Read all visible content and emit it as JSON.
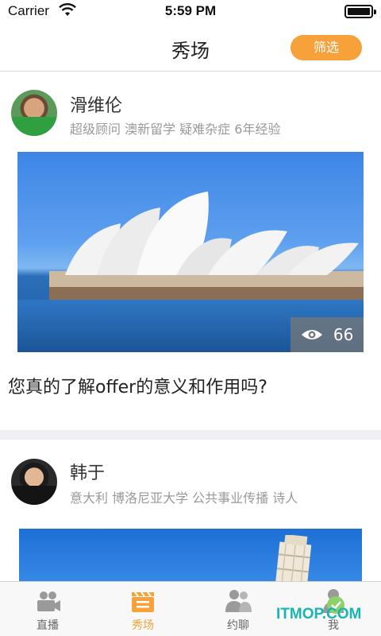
{
  "status_bar": {
    "carrier": "Carrier",
    "time": "5:59 PM",
    "icons": [
      "wifi-icon",
      "battery-icon"
    ]
  },
  "nav": {
    "title": "秀场",
    "filter_label": "筛选",
    "accent_color": "#f7a13a"
  },
  "posts": [
    {
      "author": "滑维伦",
      "tags": "超级顾问 澳新留学 疑难杂症 6年经验",
      "image": "sydney-opera-house-photo",
      "views": "66",
      "title": "您真的了解offer的意义和作用吗?"
    },
    {
      "author": "韩于",
      "tags": "意大利 博洛尼亚大学 公共事业传播 诗人",
      "image": "leaning-tower-of-pisa-photo"
    }
  ],
  "tabbar": {
    "items": [
      {
        "label": "直播",
        "icon": "video-camera-icon",
        "active": false
      },
      {
        "label": "秀场",
        "icon": "clapperboard-icon",
        "active": true
      },
      {
        "label": "约聊",
        "icon": "people-icon",
        "active": false
      },
      {
        "label": "我",
        "icon": "person-icon",
        "active": false
      }
    ],
    "active_color": "#f7a13a",
    "inactive_color": "#9a9a9a"
  },
  "watermark": "ITMOP.COM"
}
